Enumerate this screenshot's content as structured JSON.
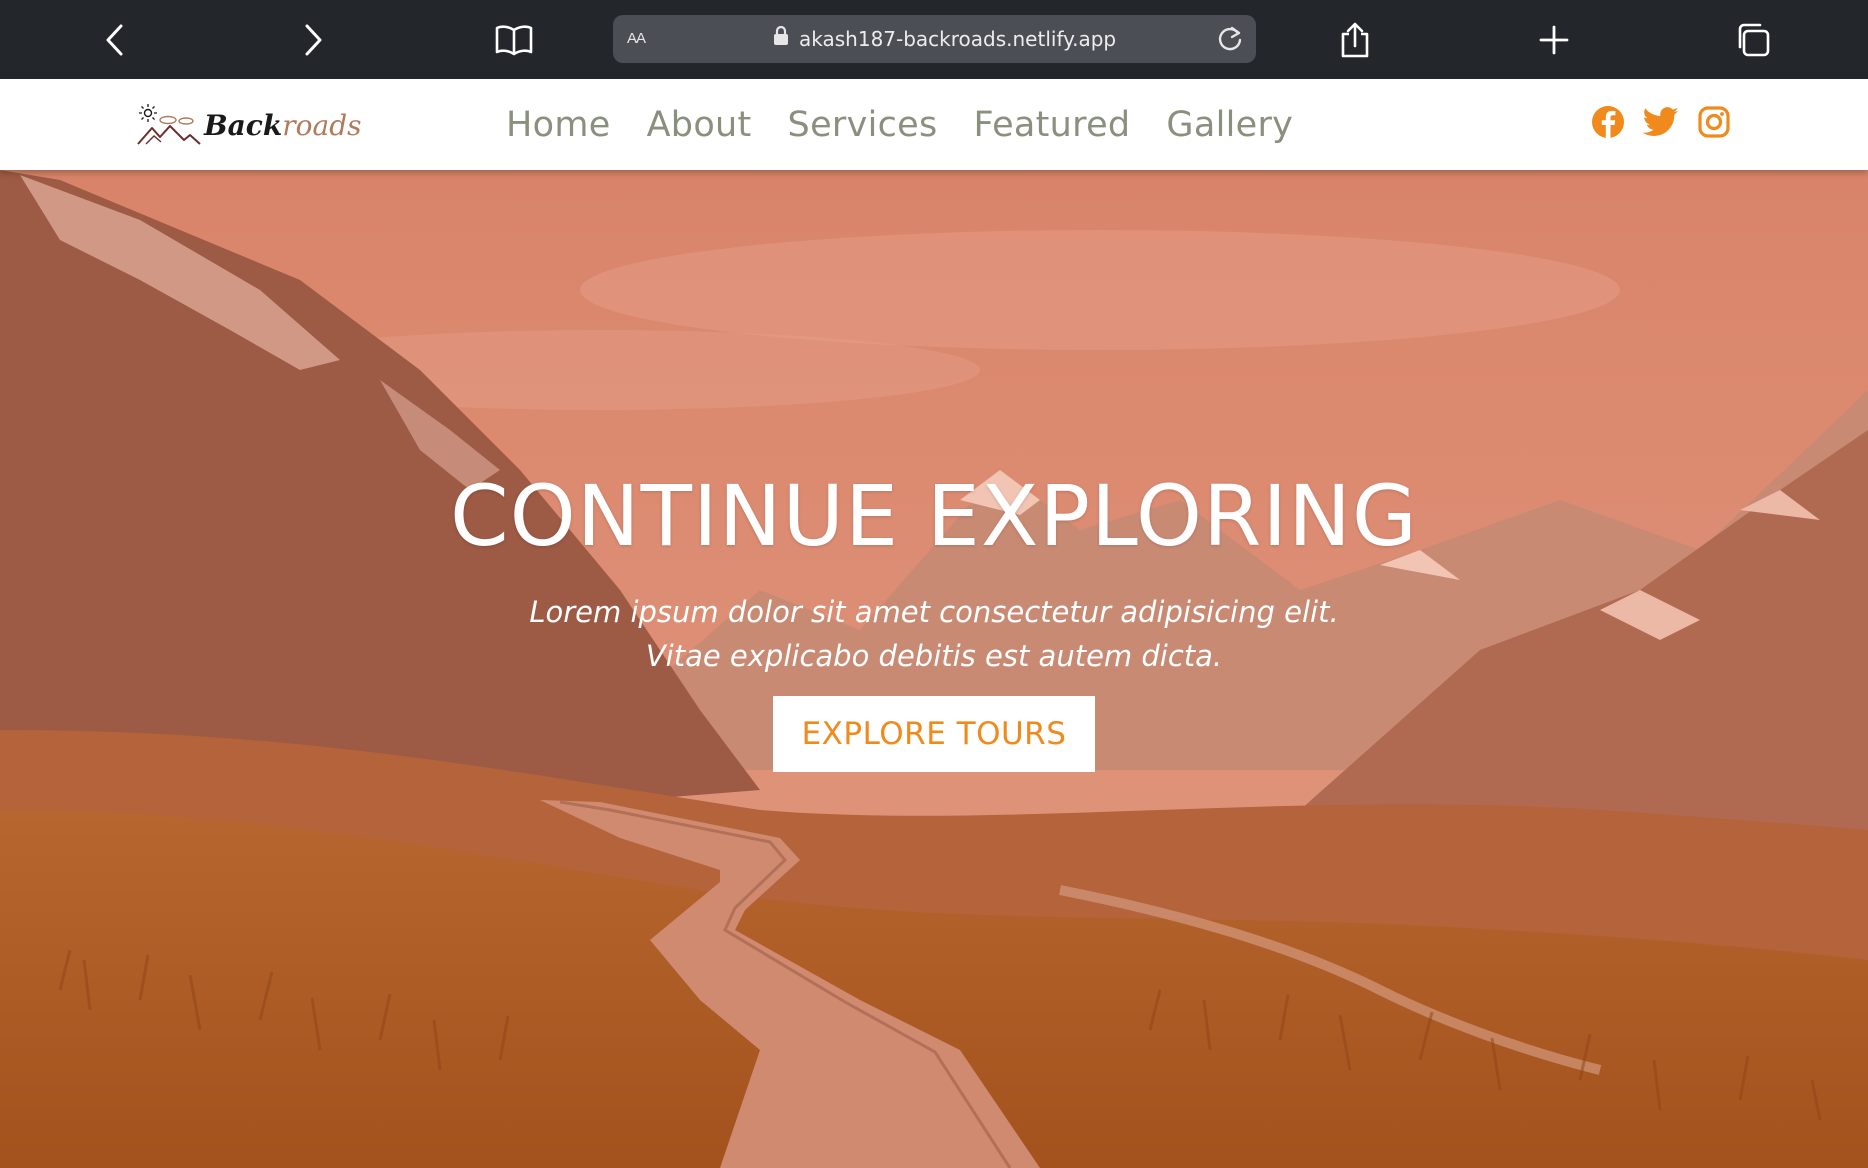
{
  "browser": {
    "aa_label": "AA",
    "url": "akash187-backroads.netlify.app",
    "icons": [
      "back-icon",
      "forward-icon",
      "bookmarks-icon",
      "lock-icon",
      "reload-icon",
      "share-icon",
      "new-tab-icon",
      "tabs-icon"
    ]
  },
  "site": {
    "logo": {
      "part1": "Back",
      "part2": "roads"
    },
    "nav": [
      "Home",
      "About",
      "Services",
      "Featured",
      "Gallery"
    ],
    "social_icons": [
      "facebook-icon",
      "twitter-icon",
      "instagram-icon"
    ],
    "colors": {
      "accent": "#f08a1c",
      "nav_text": "#8a8f7e",
      "overlay": "#e8815e"
    }
  },
  "hero": {
    "title": "CONTINUE EXPLORING",
    "subtitle_line1": "Lorem ipsum dolor sit amet consectetur adipisicing elit.",
    "subtitle_line2": "Vitae explicabo debitis est autem dicta.",
    "button": "EXPLORE TOURS"
  }
}
